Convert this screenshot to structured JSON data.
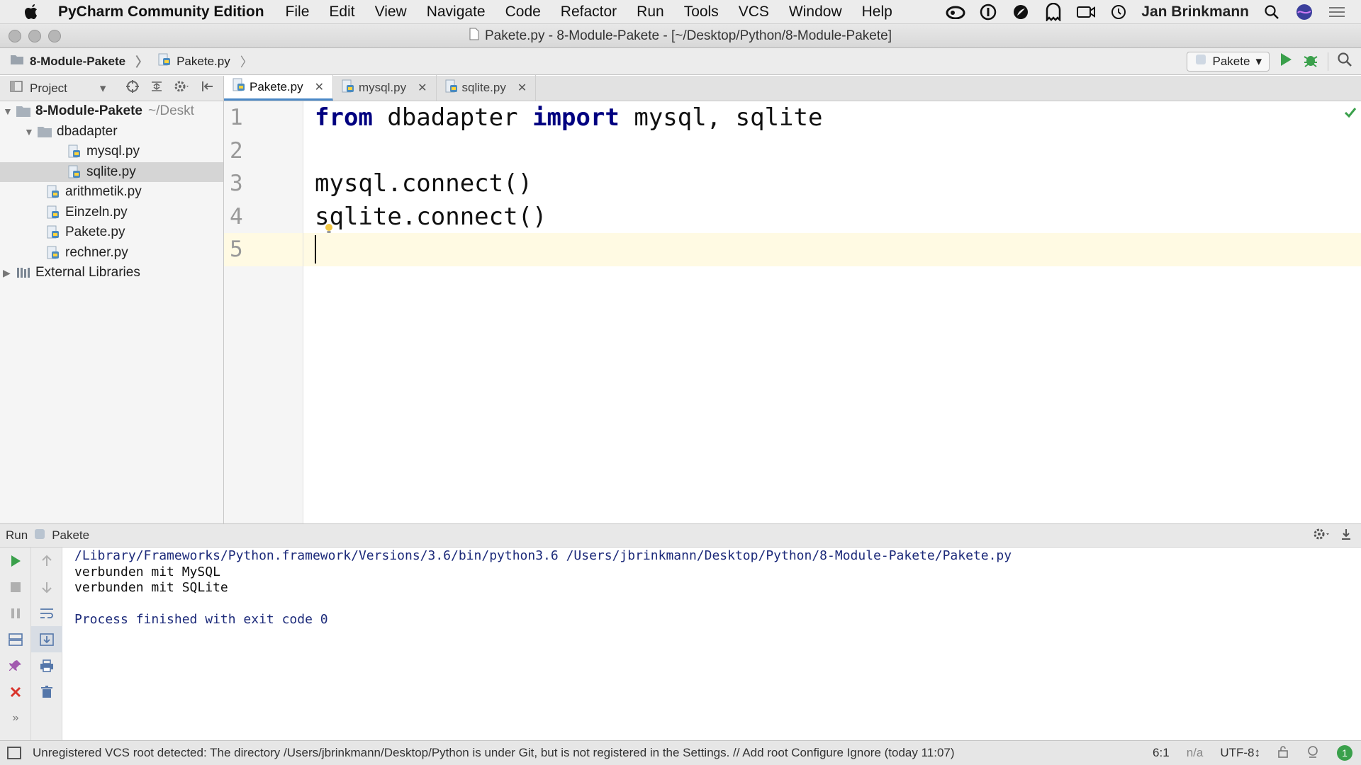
{
  "menubar": {
    "app_name": "PyCharm Community Edition",
    "menus": [
      "File",
      "Edit",
      "View",
      "Navigate",
      "Code",
      "Refactor",
      "Run",
      "Tools",
      "VCS",
      "Window",
      "Help"
    ],
    "user": "Jan Brinkmann"
  },
  "window": {
    "title": "Pakete.py - 8-Module-Pakete - [~/Desktop/Python/8-Module-Pakete]"
  },
  "navbar": {
    "breadcrumbs": [
      "8-Module-Pakete",
      "Pakete.py"
    ],
    "run_config": "Pakete"
  },
  "project_panel": {
    "label": "Project",
    "tree": [
      {
        "label": "8-Module-Pakete",
        "hint": "~/Deskt",
        "type": "folder",
        "depth": 0,
        "expanded": true,
        "bold": true
      },
      {
        "label": "dbadapter",
        "type": "folder",
        "depth": 1,
        "expanded": true
      },
      {
        "label": "mysql.py",
        "type": "py",
        "depth": 2
      },
      {
        "label": "sqlite.py",
        "type": "py",
        "depth": 2,
        "selected": true
      },
      {
        "label": "arithmetik.py",
        "type": "py",
        "depth": 1
      },
      {
        "label": "Einzeln.py",
        "type": "py",
        "depth": 1
      },
      {
        "label": "Pakete.py",
        "type": "py",
        "depth": 1
      },
      {
        "label": "rechner.py",
        "type": "py",
        "depth": 1
      },
      {
        "label": "External Libraries",
        "type": "lib",
        "depth": 0,
        "expanded": false
      }
    ]
  },
  "editor": {
    "tabs": [
      {
        "label": "Pakete.py",
        "active": true
      },
      {
        "label": "mysql.py",
        "active": false
      },
      {
        "label": "sqlite.py",
        "active": false
      }
    ],
    "line_numbers": [
      "1",
      "2",
      "3",
      "4",
      "5"
    ],
    "lines": {
      "l1_kw1": "from",
      "l1_mod": " dbadapter ",
      "l1_kw2": "import",
      "l1_rest": " mysql, sqlite",
      "l3": "mysql.connect()",
      "l4": "sqlite.connect()"
    },
    "current_line": 5
  },
  "run_panel": {
    "label": "Run",
    "config": "Pakete",
    "console": [
      "/Library/Frameworks/Python.framework/Versions/3.6/bin/python3.6 /Users/jbrinkmann/Desktop/Python/8-Module-Pakete/Pakete.py",
      "verbunden mit MySQL",
      "verbunden mit SQLite",
      "",
      "Process finished with exit code 0"
    ]
  },
  "statusbar": {
    "message": "Unregistered VCS root detected: The directory /Users/jbrinkmann/Desktop/Python is under Git, but is not registered in the Settings. // Add root  Configure  Ignore (today 11:07)",
    "position": "6:1",
    "na": "n/a",
    "encoding": "UTF-8↕",
    "events": "1"
  },
  "colors": {
    "keyword": "#000080",
    "current_line_bg": "#fffae3",
    "run_green": "#3aa04b",
    "console_blue": "#1c2a7a"
  }
}
